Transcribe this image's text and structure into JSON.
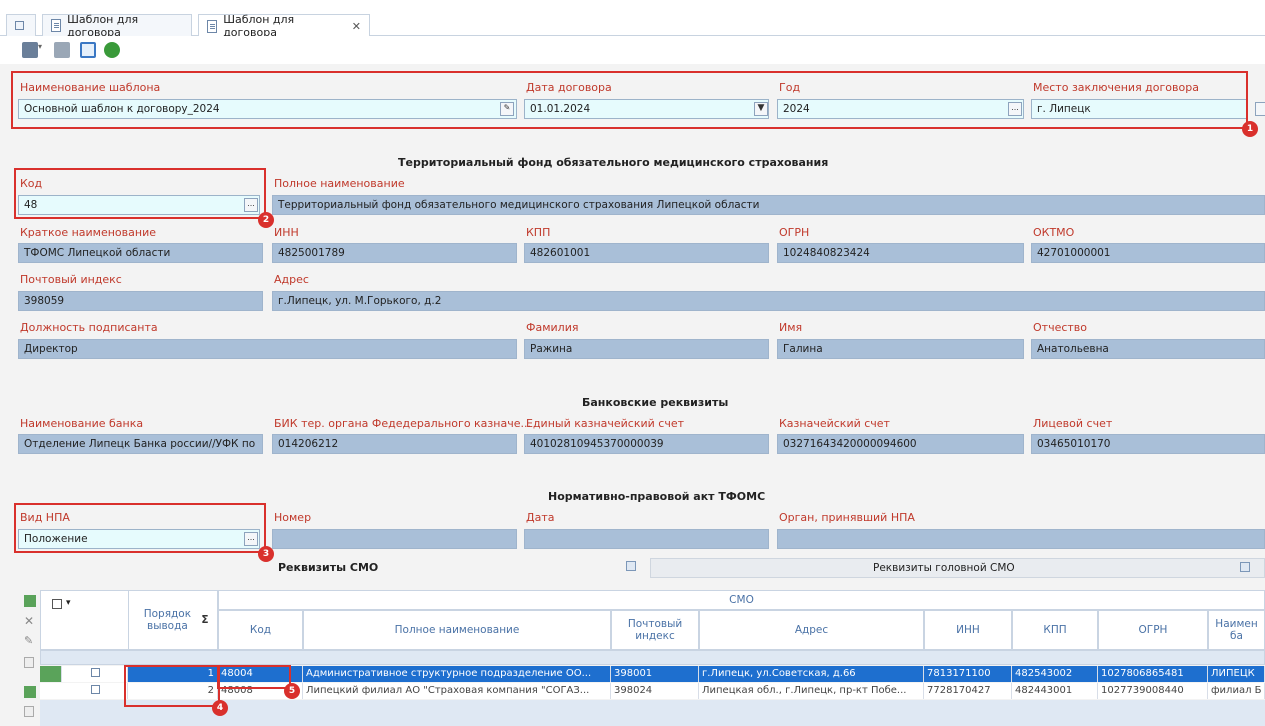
{
  "tabs": [
    "Шаблон для договора",
    "Шаблон для договора"
  ],
  "header": {
    "name_label": "Наименование шаблона",
    "name_value": "Основной шаблон к договору_2024",
    "date_label": "Дата договора",
    "date_value": "01.01.2024",
    "year_label": "Год",
    "year_value": "2024",
    "place_label": "Место заключения договора",
    "place_value": "г. Липецк"
  },
  "tfoms": {
    "title": "Территориальный фонд обязательного медицинского страхования",
    "code_label": "Код",
    "code_value": "48",
    "fullname_label": "Полное наименование",
    "fullname_value": "Территориальный фонд обязательного медицинского страхования Липецкой области",
    "short_label": "Краткое наименование",
    "short_value": "ТФОМС Липецкой области",
    "inn_label": "ИНН",
    "inn_value": "4825001789",
    "kpp_label": "КПП",
    "kpp_value": "482601001",
    "ogrn_label": "ОГРН",
    "ogrn_value": "1024840823424",
    "oktmo_label": "ОКТМО",
    "oktmo_value": "42701000001",
    "zip_label": "Почтовый индекс",
    "zip_value": "398059",
    "addr_label": "Адрес",
    "addr_value": "г.Липецк, ул. М.Горького, д.2",
    "pos_label": "Должность подписанта",
    "pos_value": "Директор",
    "last_label": "Фамилия",
    "last_value": "Ражина",
    "first_label": "Имя",
    "first_value": "Галина",
    "mid_label": "Отчество",
    "mid_value": "Анатольевна"
  },
  "bank": {
    "title": "Банковские реквизиты",
    "name_label": "Наименование банка",
    "name_value": "Отделение Липецк Банка россии//УФК по",
    "bik_label": "БИК тер. органа Федедерального казначе...",
    "bik_value": "014206212",
    "ekc_label": "Единый казначейский счет",
    "ekc_value": "40102810945370000039",
    "kc_label": "Казначейский счет",
    "kc_value": "03271643420000094600",
    "ls_label": "Лицевой счет",
    "ls_value": "03465010170"
  },
  "npa": {
    "title": "Нормативно-правовой акт ТФОМС",
    "type_label": "Вид НПА",
    "type_value": "Положение",
    "num_label": "Номер",
    "date_label": "Дата",
    "org_label": "Орган, принявший НПА"
  },
  "smo": {
    "panel_left": "Реквизиты СМО",
    "panel_right": "Реквизиты головной СМО",
    "group": "СМО",
    "cols": {
      "order": "Порядок вывода",
      "code": "Код",
      "fullname": "Полное наименование",
      "zip": "Почтовый индекс",
      "addr": "Адрес",
      "inn": "ИНН",
      "kpp": "КПП",
      "ogrn": "ОГРН",
      "bank": "Наимен ба"
    },
    "rows": [
      {
        "order": "1",
        "code": "48004",
        "fullname": "Административное структурное подразделение ОО...",
        "zip": "398001",
        "addr": "г.Липецк, ул.Советская, д.66",
        "inn": "7813171100",
        "kpp": "482543002",
        "ogrn": "1027806865481",
        "bank": "ЛИПЕЦК"
      },
      {
        "order": "2",
        "code": "48008",
        "fullname": "Липецкий филиал АО \"Страховая компания \"СОГАЗ...",
        "zip": "398024",
        "addr": "Липецкая обл., г.Липецк, пр-кт Побе...",
        "inn": "7728170427",
        "kpp": "482443001",
        "ogrn": "1027739008440",
        "bank": "филиал Б"
      }
    ]
  },
  "markers": [
    "1",
    "2",
    "3",
    "4",
    "5"
  ],
  "colors": {
    "highlight": "#d9302c",
    "field": "#a9bfd8",
    "selected": "#1e6fcf"
  }
}
